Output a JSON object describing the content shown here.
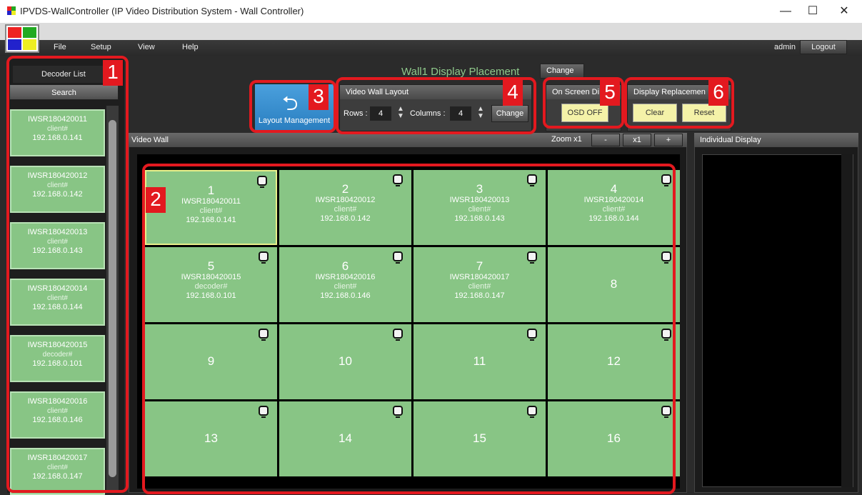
{
  "window": {
    "title": "IPVDS-WallController (IP Video Distribution System - Wall Controller)",
    "minimize": "—",
    "maximize": "☐",
    "close": "✕"
  },
  "menu": {
    "file": "File",
    "setup": "Setup",
    "view": "View",
    "help": "Help",
    "user": "admin",
    "logout": "Logout"
  },
  "left_panel": {
    "title": "Decoder List",
    "search": "Search",
    "decoders": [
      {
        "name": "IWSR180420011",
        "type": "client#",
        "ip": "192.168.0.141"
      },
      {
        "name": "IWSR180420012",
        "type": "client#",
        "ip": "192.168.0.142"
      },
      {
        "name": "IWSR180420013",
        "type": "client#",
        "ip": "192.168.0.143"
      },
      {
        "name": "IWSR180420014",
        "type": "client#",
        "ip": "192.168.0.144"
      },
      {
        "name": "IWSR180420015",
        "type": "decoder#",
        "ip": "192.168.0.101"
      },
      {
        "name": "IWSR180420016",
        "type": "client#",
        "ip": "192.168.0.146"
      },
      {
        "name": "IWSR180420017",
        "type": "client#",
        "ip": "192.168.0.147"
      }
    ]
  },
  "header": {
    "wall_title": "Wall1 Display Placement",
    "change": "Change"
  },
  "layout_management": {
    "label": "Layout Management",
    "icon": "return-arrow-icon"
  },
  "video_wall_layout": {
    "title": "Video Wall Layout",
    "rows_label": "Rows :",
    "rows": "4",
    "columns_label": "Columns :",
    "columns": "4",
    "change": "Change"
  },
  "osd": {
    "title": "On Screen Di",
    "button": "OSD OFF"
  },
  "display_replacement": {
    "title": "Display Replacemen",
    "clear": "Clear",
    "reset": "Reset"
  },
  "video_wall": {
    "title": "Video Wall",
    "zoom_label": "Zoom x1",
    "zoom_out": "-",
    "zoom_reset": "x1",
    "zoom_in": "+",
    "cells": [
      {
        "num": "1",
        "name": "IWSR180420011",
        "type": "client#",
        "ip": "192.168.0.141",
        "selected": true
      },
      {
        "num": "2",
        "name": "IWSR180420012",
        "type": "client#",
        "ip": "192.168.0.142"
      },
      {
        "num": "3",
        "name": "IWSR180420013",
        "type": "client#",
        "ip": "192.168.0.143"
      },
      {
        "num": "4",
        "name": "IWSR180420014",
        "type": "client#",
        "ip": "192.168.0.144"
      },
      {
        "num": "5",
        "name": "IWSR180420015",
        "type": "decoder#",
        "ip": "192.168.0.101"
      },
      {
        "num": "6",
        "name": "IWSR180420016",
        "type": "client#",
        "ip": "192.168.0.146"
      },
      {
        "num": "7",
        "name": "IWSR180420017",
        "type": "client#",
        "ip": "192.168.0.147"
      },
      {
        "num": "8"
      },
      {
        "num": "9"
      },
      {
        "num": "10"
      },
      {
        "num": "11"
      },
      {
        "num": "12"
      },
      {
        "num": "13"
      },
      {
        "num": "14"
      },
      {
        "num": "15"
      },
      {
        "num": "16"
      }
    ]
  },
  "individual_display": {
    "title": "Individual Display"
  },
  "annotations": [
    "1",
    "2",
    "3",
    "4",
    "5",
    "6"
  ],
  "colors": {
    "cell": "#88c585",
    "annotation": "#e3191f",
    "accent": "#2a7ec0",
    "highlight_button": "#f4f2a8"
  }
}
